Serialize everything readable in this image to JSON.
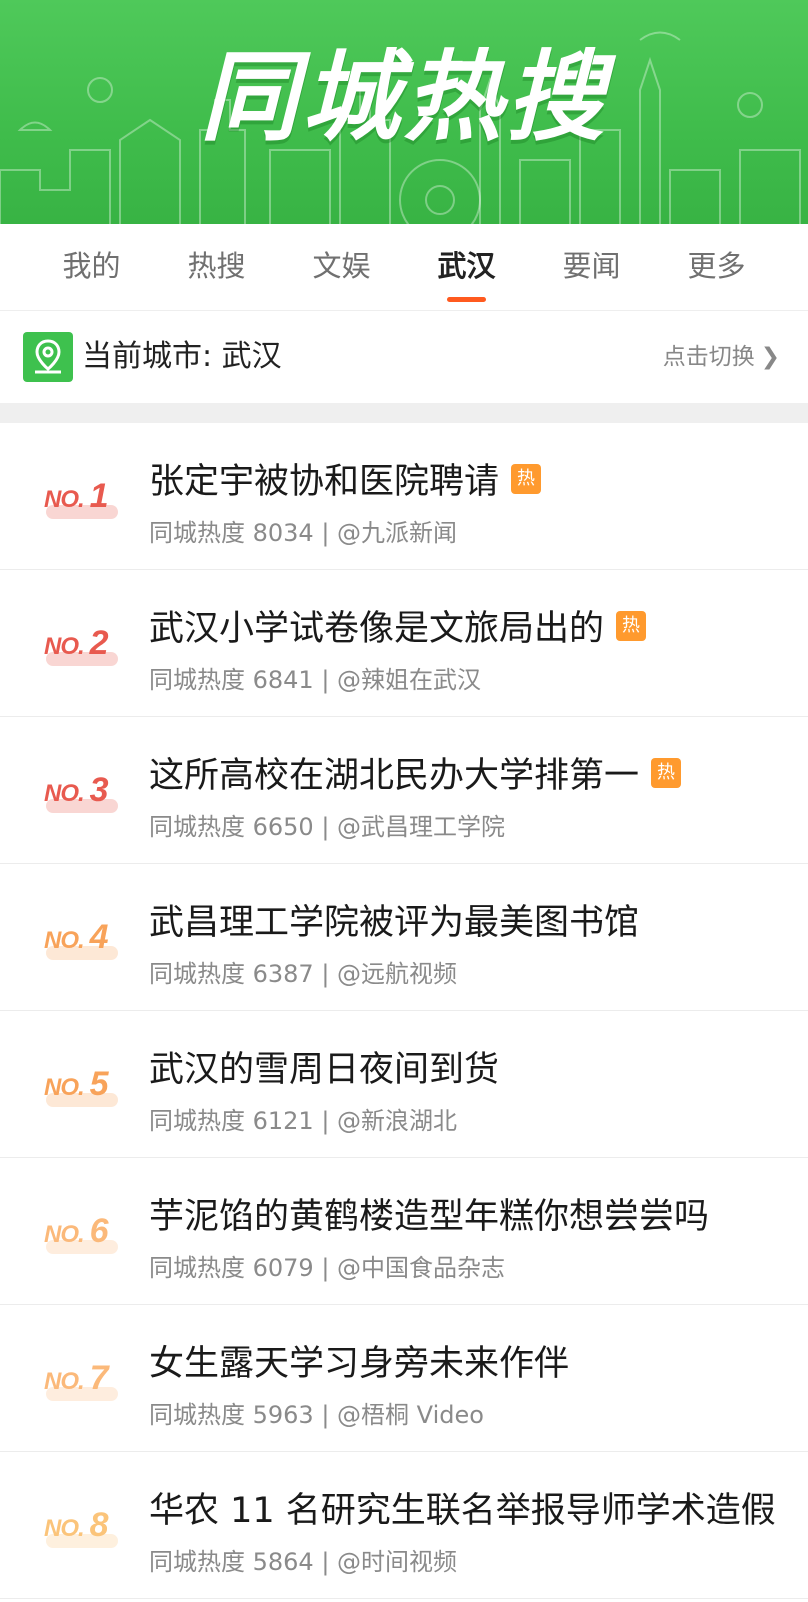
{
  "banner": {
    "title": "同城热搜"
  },
  "tabs": [
    {
      "label": "我的",
      "active": false
    },
    {
      "label": "热搜",
      "active": false
    },
    {
      "label": "文娱",
      "active": false
    },
    {
      "label": "武汉",
      "active": true
    },
    {
      "label": "要闻",
      "active": false
    },
    {
      "label": "更多",
      "active": false
    }
  ],
  "city_bar": {
    "label": "当前城市: 武汉",
    "switch_label": "点击切换"
  },
  "colors": {
    "banner_green": "#44c250",
    "accent_orange": "#ff5a1f",
    "hot_badge": "#ff9a2e",
    "rank_red": "#e85a4f",
    "rank_orange": "#f8a35a",
    "rank_light": "#fbc47a"
  },
  "list": [
    {
      "rank_prefix": "NO.",
      "rank": "1",
      "title": "张定宇被协和医院聘请",
      "hot": true,
      "hot_label": "热",
      "meta": "同城热度 8034 | @九派新闻"
    },
    {
      "rank_prefix": "NO.",
      "rank": "2",
      "title": "武汉小学试卷像是文旅局出的",
      "hot": true,
      "hot_label": "热",
      "meta": "同城热度 6841 | @辣姐在武汉"
    },
    {
      "rank_prefix": "NO.",
      "rank": "3",
      "title": "这所高校在湖北民办大学排第一",
      "hot": true,
      "hot_label": "热",
      "meta": "同城热度 6650 | @武昌理工学院"
    },
    {
      "rank_prefix": "NO.",
      "rank": "4",
      "title": "武昌理工学院被评为最美图书馆",
      "hot": false,
      "hot_label": "",
      "meta": "同城热度 6387 | @远航视频"
    },
    {
      "rank_prefix": "NO.",
      "rank": "5",
      "title": "武汉的雪周日夜间到货",
      "hot": false,
      "hot_label": "",
      "meta": "同城热度 6121 | @新浪湖北"
    },
    {
      "rank_prefix": "NO.",
      "rank": "6",
      "title": "芋泥馅的黄鹤楼造型年糕你想尝尝吗",
      "hot": false,
      "hot_label": "",
      "meta": "同城热度 6079 | @中国食品杂志"
    },
    {
      "rank_prefix": "NO.",
      "rank": "7",
      "title": "女生露天学习身旁未来作伴",
      "hot": false,
      "hot_label": "",
      "meta": "同城热度 5963 | @梧桐 Video"
    },
    {
      "rank_prefix": "NO.",
      "rank": "8",
      "title": "华农 11 名研究生联名举报导师学术造假",
      "hot": false,
      "hot_label": "",
      "meta": "同城热度 5864 | @时间视频"
    }
  ]
}
